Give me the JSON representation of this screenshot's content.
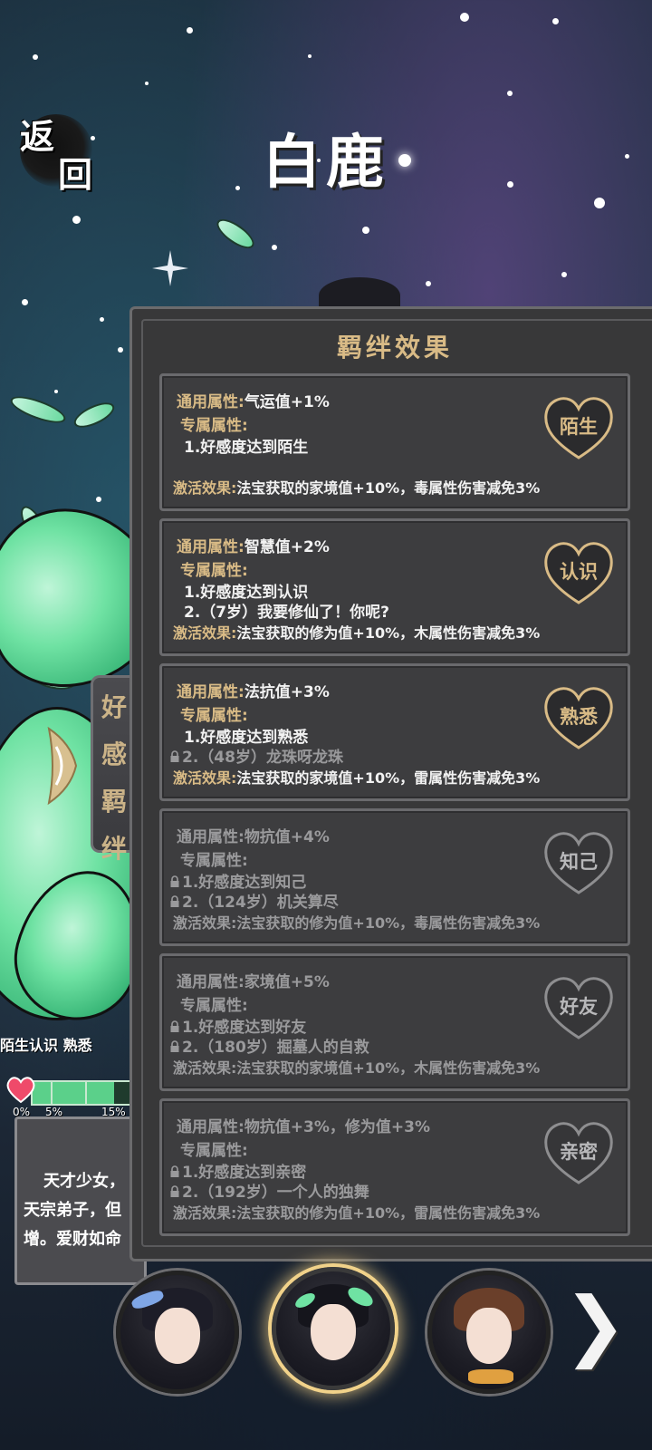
{
  "header": {
    "back_char_1": "返",
    "back_char_2": "回",
    "character_name": "白鹿"
  },
  "side_tab": {
    "label_chars": [
      "好",
      "感",
      "羁",
      "绊"
    ]
  },
  "affinity": {
    "stage_labels": "陌生认识  熟悉",
    "markers": [
      "0%",
      "5%",
      "15%"
    ],
    "progress_percent": 80
  },
  "description": {
    "lines": [
      "天才少女，",
      "天宗弟子，但",
      "增。爱财如命"
    ]
  },
  "bond_panel": {
    "title": "羁绊效果",
    "general_label": "通用属性:",
    "exclusive_label": "专属属性:",
    "activate_label": "激活效果:",
    "cards": [
      {
        "badge": "陌生",
        "general_value": "气运值+1%",
        "requirements": [
          {
            "text": "1.好感度达到陌生",
            "locked": false
          }
        ],
        "effect": "法宝获取的家境值+10%，毒属性伤害减免3%",
        "active": true
      },
      {
        "badge": "认识",
        "general_value": "智慧值+2%",
        "requirements": [
          {
            "text": "1.好感度达到认识",
            "locked": false
          },
          {
            "text": "2.（7岁）我要修仙了！你呢?",
            "locked": false
          }
        ],
        "effect": "法宝获取的修为值+10%，木属性伤害减免3%",
        "active": true
      },
      {
        "badge": "熟悉",
        "general_value": "法抗值+3%",
        "requirements": [
          {
            "text": "1.好感度达到熟悉",
            "locked": false
          },
          {
            "text": "2.（48岁）龙珠呀龙珠",
            "locked": true
          }
        ],
        "effect": "法宝获取的家境值+10%，雷属性伤害减免3%",
        "active": true
      },
      {
        "badge": "知己",
        "general_value": "物抗值+4%",
        "requirements": [
          {
            "text": "1.好感度达到知己",
            "locked": true
          },
          {
            "text": "2.（124岁）机关算尽",
            "locked": true
          }
        ],
        "effect": "法宝获取的修为值+10%，毒属性伤害减免3%",
        "active": false
      },
      {
        "badge": "好友",
        "general_value": "家境值+5%",
        "requirements": [
          {
            "text": "1.好感度达到好友",
            "locked": true
          },
          {
            "text": "2.（180岁）掘墓人的自救",
            "locked": true
          }
        ],
        "effect": "法宝获取的家境值+10%，木属性伤害减免3%",
        "active": false
      },
      {
        "badge": "亲密",
        "general_value": "物抗值+3%，修为值+3%",
        "requirements": [
          {
            "text": "1.好感度达到亲密",
            "locked": true
          },
          {
            "text": "2.（192岁）一个人的独舞",
            "locked": true
          }
        ],
        "effect": "法宝获取的修为值+10%，雷属性伤害减免3%",
        "active": false
      }
    ]
  },
  "colors": {
    "gold": "#d9bb86",
    "panel": "#383839",
    "dim_text": "#9a9a9c",
    "leaf_green": "#6fe2a3"
  },
  "navigation": {
    "next_glyph": "❯"
  }
}
